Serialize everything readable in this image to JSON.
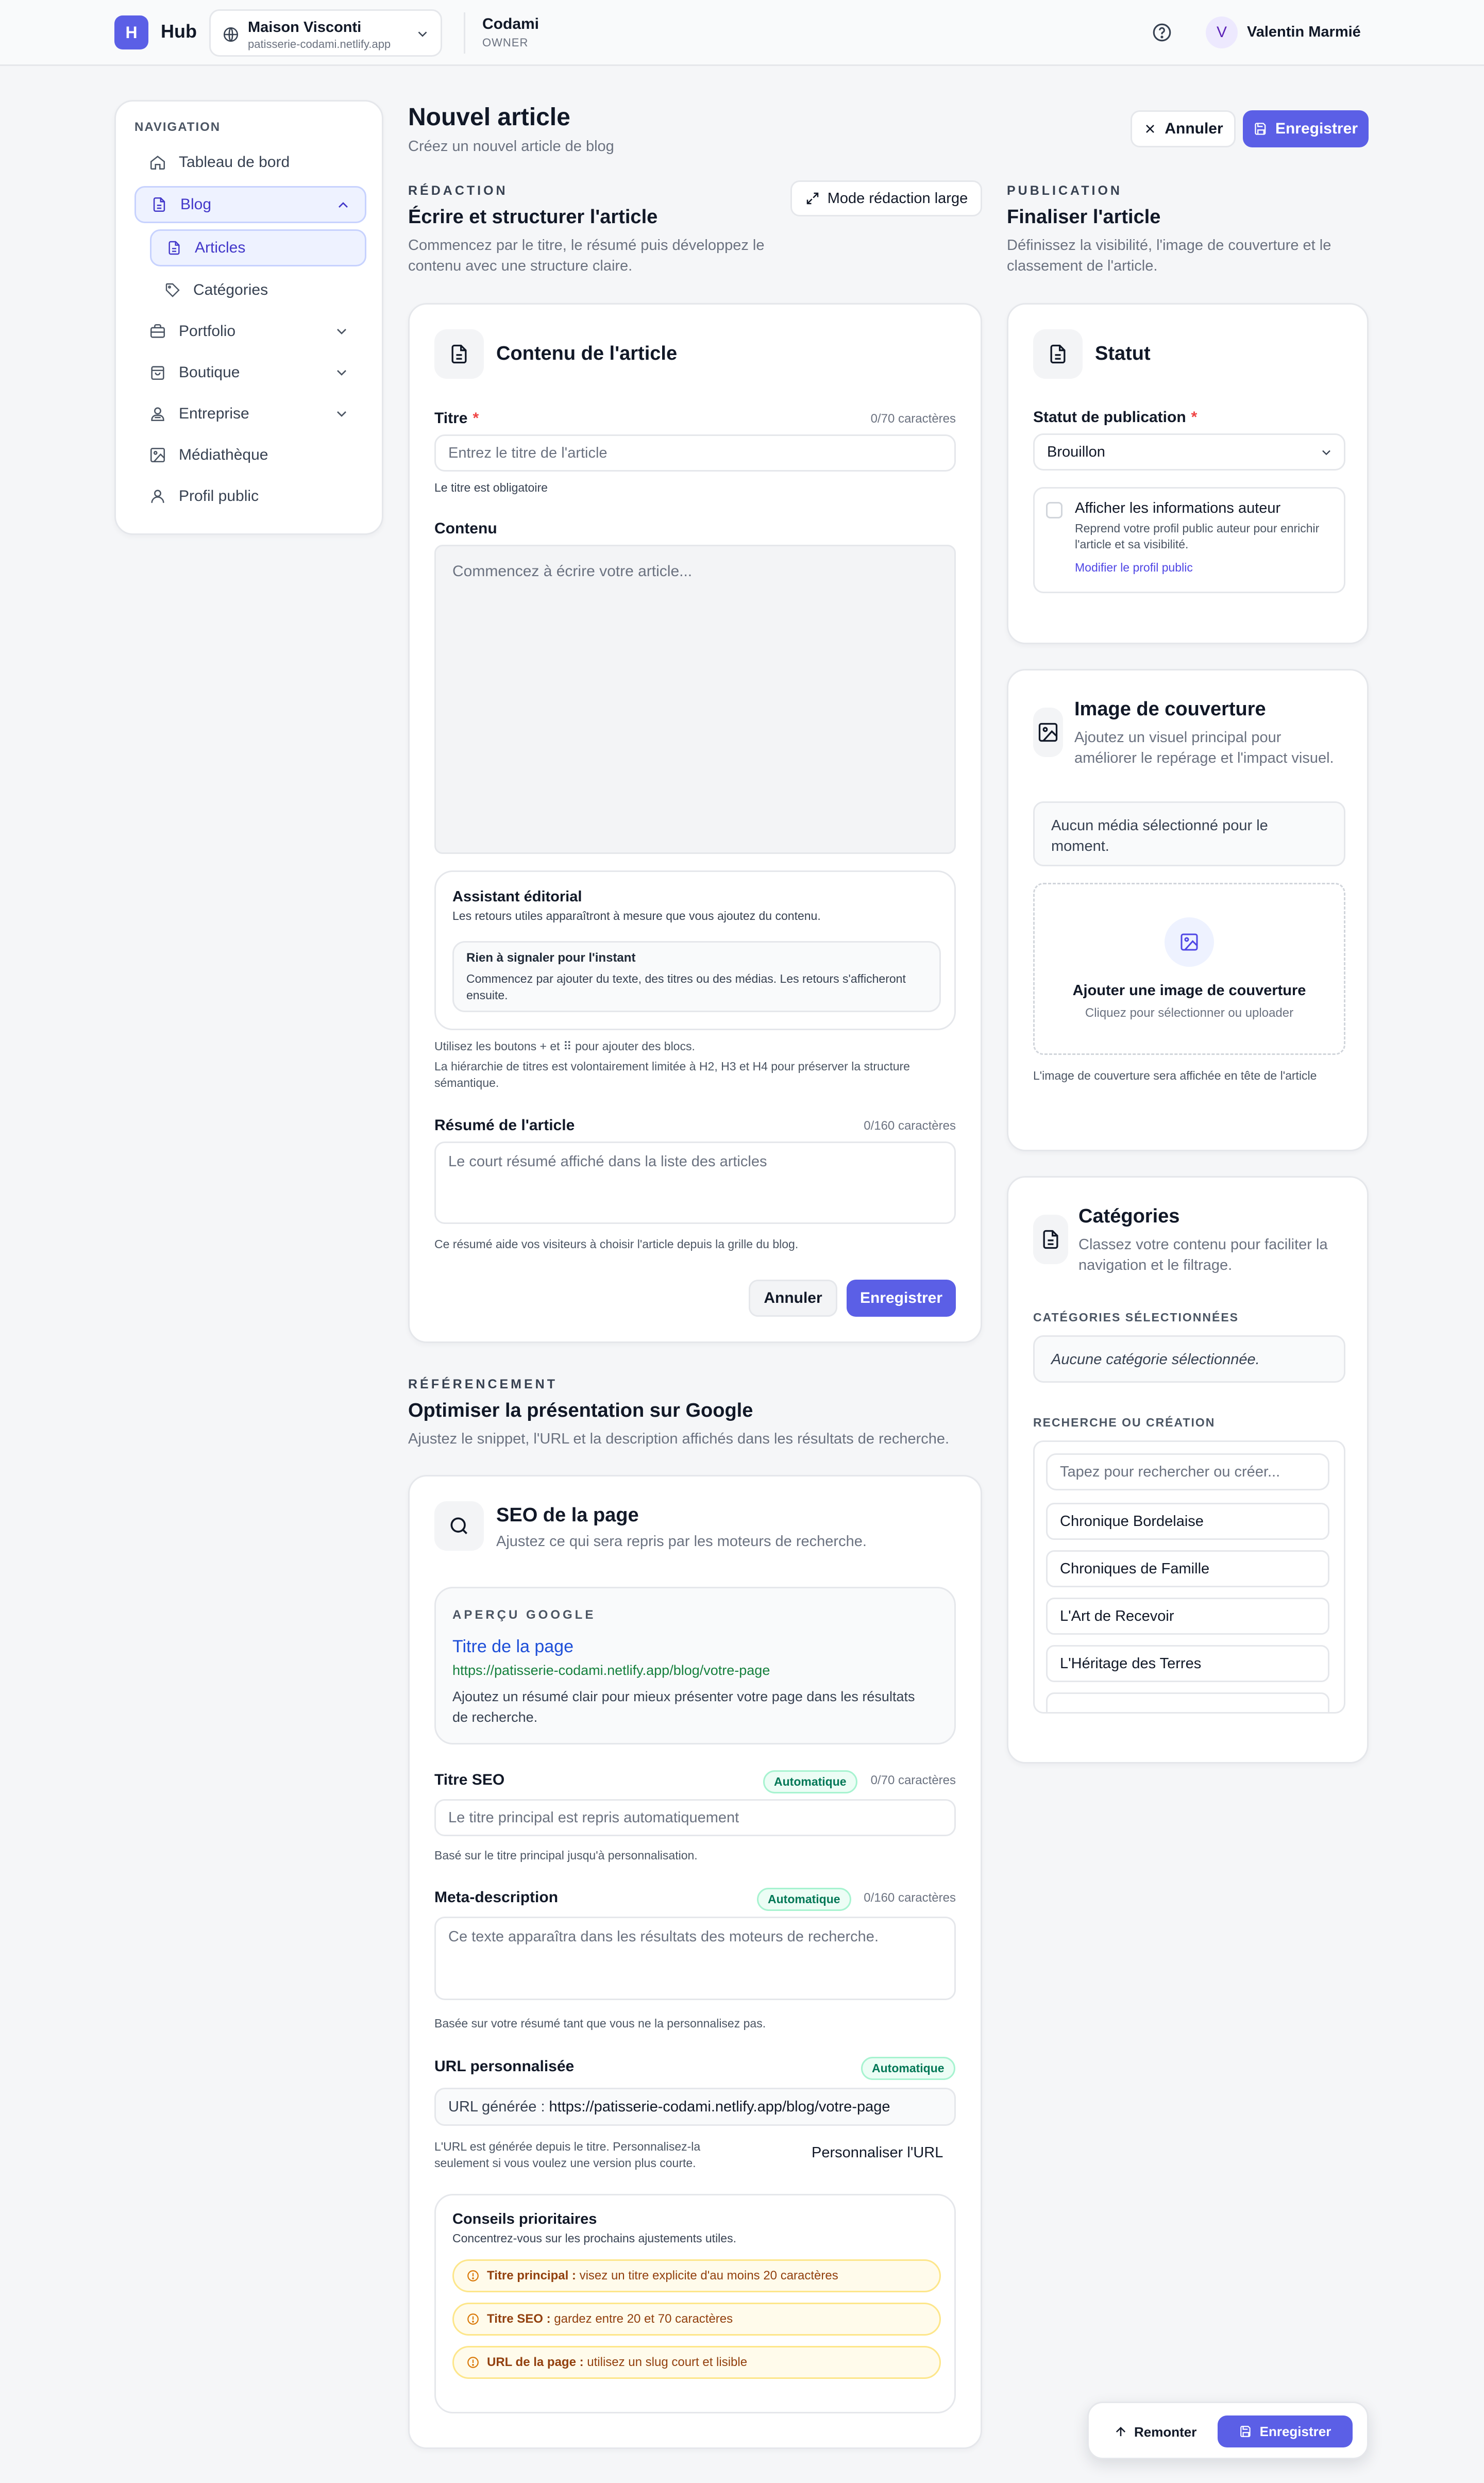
{
  "topbar": {
    "logo_letter": "H",
    "app_name": "Hub",
    "workspace_name": "Maison Visconti",
    "workspace_url": "patisserie-codami.netlify.app",
    "org_name": "Codami",
    "org_role": "OWNER",
    "user_initial": "V",
    "user_name": "Valentin Marmié"
  },
  "sidebar": {
    "heading": "NAVIGATION",
    "items": [
      {
        "label": "Tableau de bord",
        "icon": "home-icon"
      },
      {
        "label": "Blog",
        "icon": "document-icon"
      },
      {
        "label": "Articles",
        "icon": "document-icon"
      },
      {
        "label": "Catégories",
        "icon": "tag-icon"
      },
      {
        "label": "Portfolio",
        "icon": "briefcase-icon"
      },
      {
        "label": "Boutique",
        "icon": "bag-icon"
      },
      {
        "label": "Entreprise",
        "icon": "users-icon"
      },
      {
        "label": "Médiathèque",
        "icon": "image-icon"
      },
      {
        "label": "Profil public",
        "icon": "user-icon"
      }
    ]
  },
  "page": {
    "title": "Nouvel article",
    "subtitle": "Créez un nouvel article de blog",
    "cancel_label": "Annuler",
    "save_label": "Enregistrer"
  },
  "redaction": {
    "eyebrow": "RÉDACTION",
    "title": "Écrire et structurer l'article",
    "description": "Commencez par le titre, le résumé puis développez le contenu avec une structure claire.",
    "wide_mode_label": "Mode rédaction large"
  },
  "content_card": {
    "title": "Contenu de l'article",
    "title_label": "Titre",
    "title_counter": "0/70 caractères",
    "title_placeholder": "Entrez le titre de l'article",
    "title_error": "Le titre est obligatoire",
    "content_label": "Contenu",
    "content_placeholder": "Commencez à écrire votre article...",
    "assistant_title": "Assistant éditorial",
    "assistant_desc": "Les retours utiles apparaîtront à mesure que vous ajoutez du contenu.",
    "assistant_box_title": "Rien à signaler pour l'instant",
    "assistant_box_desc": "Commencez par ajouter du texte, des titres ou des médias. Les retours s'afficheront ensuite.",
    "help_line1": "Utilisez les boutons + et ⠿ pour ajouter des blocs.",
    "help_line2": "La hiérarchie de titres est volontairement limitée à H2, H3 et H4 pour préserver la structure sémantique.",
    "summary_label": "Résumé de l'article",
    "summary_counter": "0/160 caractères",
    "summary_placeholder": "Le court résumé affiché dans la liste des articles",
    "summary_help": "Ce résumé aide vos visiteurs à choisir l'article depuis la grille du blog.",
    "cancel_label": "Annuler",
    "save_label": "Enregistrer"
  },
  "seo_section": {
    "eyebrow": "RÉFÉRENCEMENT",
    "title": "Optimiser la présentation sur Google",
    "description": "Ajustez le snippet, l'URL et la description affichés dans les résultats de recherche."
  },
  "seo_card": {
    "title": "SEO de la page",
    "subtitle": "Ajustez ce qui sera repris par les moteurs de recherche.",
    "preview_eyebrow": "APERÇU GOOGLE",
    "preview_title": "Titre de la page",
    "preview_url": "https://patisserie-codami.netlify.app/blog/votre-page",
    "preview_desc": "Ajoutez un résumé clair pour mieux présenter votre page dans les résultats de recherche.",
    "seo_title_label": "Titre SEO",
    "auto_badge": "Automatique",
    "seo_title_counter": "0/70 caractères",
    "seo_title_placeholder": "Le titre principal est repris automatiquement",
    "seo_title_help": "Basé sur le titre principal jusqu'à personnalisation.",
    "meta_label": "Meta-description",
    "meta_counter": "0/160 caractères",
    "meta_placeholder": "Ce texte apparaîtra dans les résultats des moteurs de recherche.",
    "meta_help": "Basée sur votre résumé tant que vous ne la personnalisez pas.",
    "url_label": "URL personnalisée",
    "url_prefix": "URL générée :",
    "url_value": "https://patisserie-codami.netlify.app/blog/votre-page",
    "url_help": "L'URL est générée depuis le titre. Personnalisez-la seulement si vous voulez une version plus courte.",
    "url_customize": "Personnaliser l'URL",
    "tips_title": "Conseils prioritaires",
    "tips_desc": "Concentrez-vous sur les prochains ajustements utiles.",
    "tips": [
      {
        "key": "Titre principal :",
        "text": "visez un titre explicite d'au moins 20 caractères"
      },
      {
        "key": "Titre SEO :",
        "text": "gardez entre 20 et 70 caractères"
      },
      {
        "key": "URL de la page :",
        "text": "utilisez un slug court et lisible"
      }
    ]
  },
  "publication": {
    "eyebrow": "PUBLICATION",
    "title": "Finaliser l'article",
    "description": "Définissez la visibilité, l'image de couverture et le classement de l'article."
  },
  "status_card": {
    "title": "Statut",
    "status_label": "Statut de publication",
    "status_value": "Brouillon",
    "author_title": "Afficher les informations auteur",
    "author_desc": "Reprend votre profil public auteur pour enrichir l'article et sa visibilité.",
    "author_link": "Modifier le profil public"
  },
  "cover_card": {
    "title": "Image de couverture",
    "subtitle": "Ajoutez un visuel principal pour améliorer le repérage et l'impact visuel.",
    "empty": "Aucun média sélectionné pour le moment.",
    "drop_title": "Ajouter une image de couverture",
    "drop_desc": "Cliquez pour sélectionner ou uploader",
    "help": "L'image de couverture sera affichée en tête de l'article"
  },
  "categories_card": {
    "title": "Catégories",
    "subtitle": "Classez votre contenu pour faciliter la navigation et le filtrage.",
    "selected_heading": "CATÉGORIES SÉLECTIONNÉES",
    "selected_empty": "Aucune catégorie sélectionnée.",
    "search_heading": "RECHERCHE OU CRÉATION",
    "search_placeholder": "Tapez pour rechercher ou créer...",
    "options": [
      "Chronique Bordelaise",
      "Chroniques de Famille",
      "L'Art de Recevoir",
      "L'Héritage des Terres"
    ]
  },
  "floating": {
    "top_label": "Remonter",
    "save_label": "Enregistrer"
  },
  "colors": {
    "accent": "#5b5fe6",
    "danger": "#ef4444",
    "success": "#047857",
    "warning": "#92400e"
  }
}
